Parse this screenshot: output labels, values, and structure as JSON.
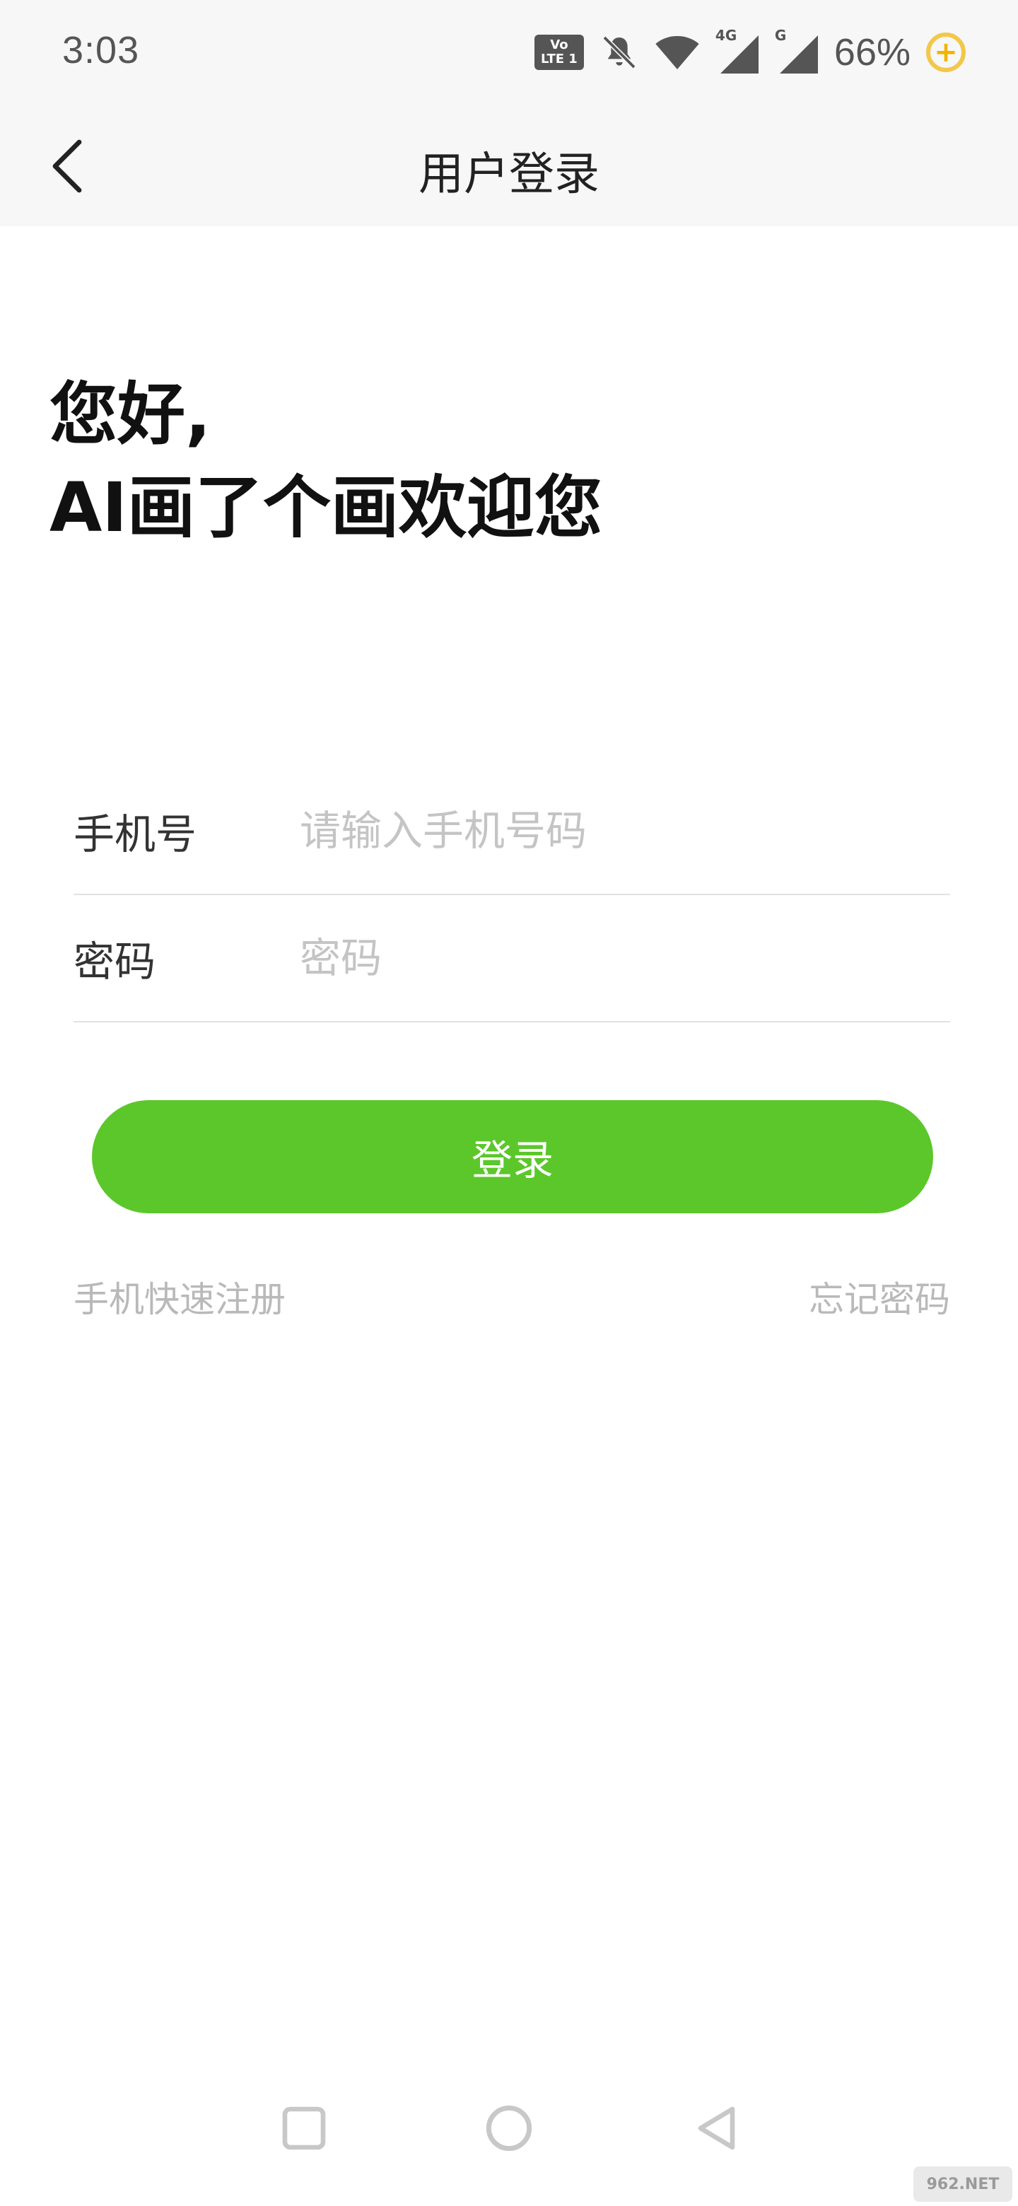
{
  "status_bar": {
    "time": "3:03",
    "volte_top": "Vo",
    "volte_bottom": "LTE 1",
    "network_4g": "4G",
    "network_g": "G",
    "battery": "66%",
    "battery_symbol": "+"
  },
  "header": {
    "back_icon": "chevron-left-icon",
    "title": "用户登录"
  },
  "greeting": {
    "line1": "您好,",
    "line2": "AI画了个画欢迎您"
  },
  "form": {
    "phone_label": "手机号",
    "phone_placeholder": "请输入手机号码",
    "phone_value": "",
    "password_label": "密码",
    "password_placeholder": "密码",
    "password_value": ""
  },
  "login_button": "登录",
  "links": {
    "register": "手机快速注册",
    "forgot": "忘记密码"
  },
  "nav": {
    "recent_icon": "square-icon",
    "home_icon": "circle-icon",
    "back_icon": "triangle-back-icon"
  },
  "watermark": "962.NET",
  "colors": {
    "accent": "#5cc72b",
    "header_bg": "#f7f7f7",
    "placeholder": "#c4c4c4",
    "link": "#b9b9b9"
  }
}
